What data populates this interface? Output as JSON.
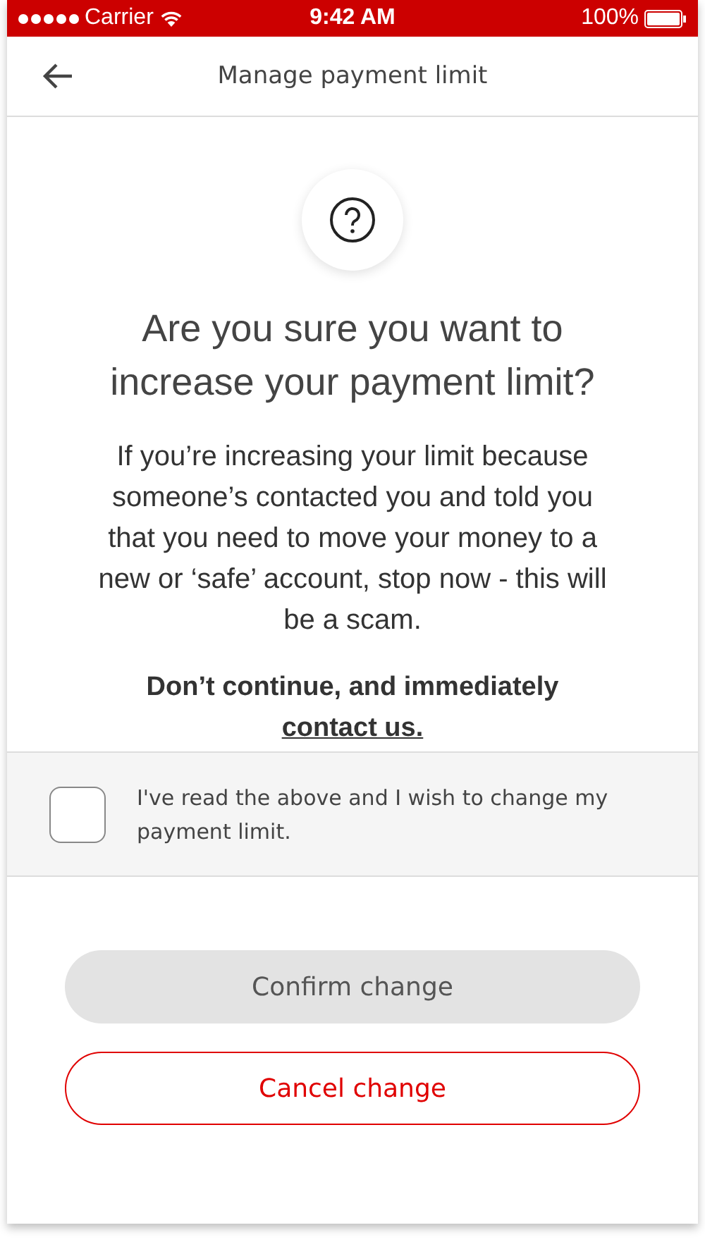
{
  "status_bar": {
    "carrier": "Carrier",
    "time": "9:42 AM",
    "battery": "100%"
  },
  "header": {
    "title": "Manage payment limit"
  },
  "dialog": {
    "heading": "Are you sure you want to increase your payment limit?",
    "body": "If you’re increasing your limit because someone’s contacted you and told you that you need to move your money to a new or ‘safe’ account, stop now - this will be a scam.",
    "warning": "Don’t continue, and immediately",
    "link": "contact us."
  },
  "consent": {
    "label": "I've read the above and I wish to change my payment limit.",
    "checked": false
  },
  "buttons": [
    {
      "label": "Confirm change",
      "kind": "primary",
      "disabled": true
    },
    {
      "label": "Cancel change",
      "kind": "outline",
      "disabled": false
    }
  ]
}
